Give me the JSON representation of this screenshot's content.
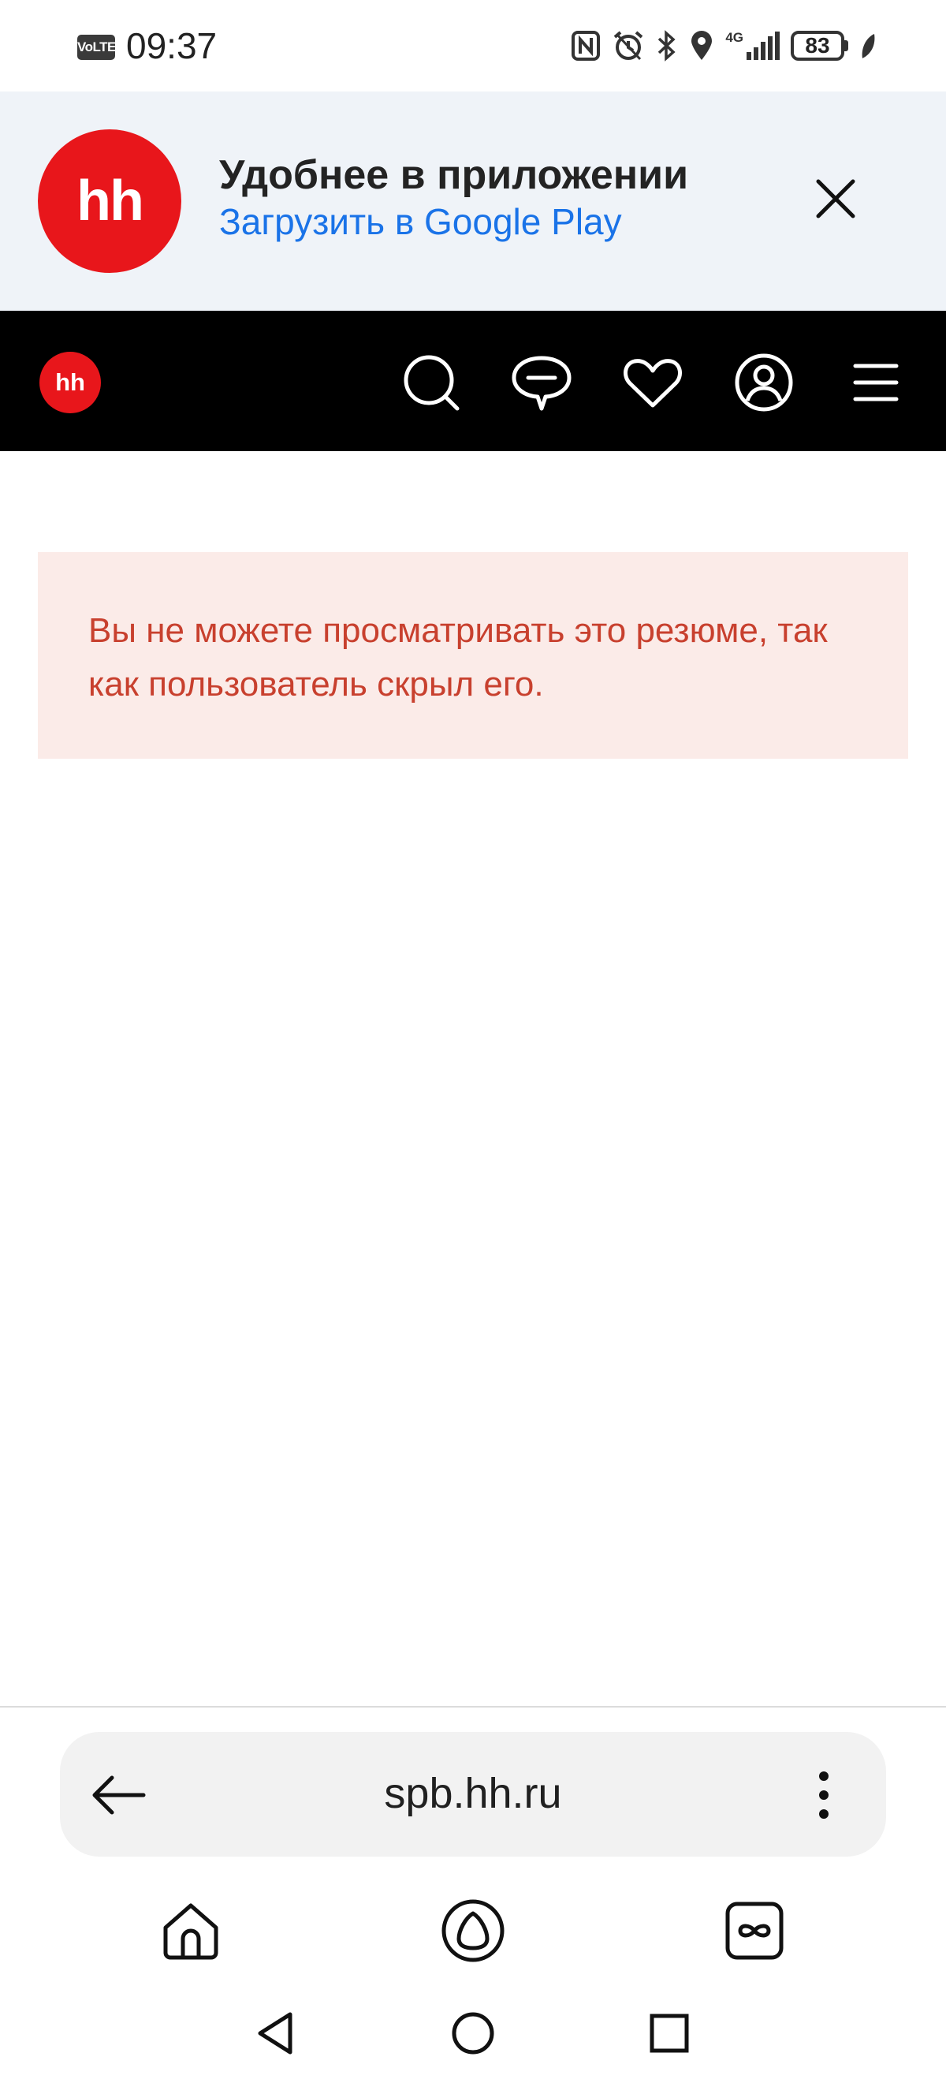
{
  "status_bar": {
    "volte": "VoLTE",
    "time": "09:37",
    "network": "4G",
    "battery": "83",
    "icons": [
      "nfc-icon",
      "alarm-icon",
      "bluetooth-icon",
      "location-icon",
      "signal-icon",
      "battery-icon",
      "leaf-icon"
    ]
  },
  "app_banner": {
    "logo_text": "hh",
    "title": "Удобнее в приложении",
    "link": "Загрузить в Google Play",
    "close_icon": "close-icon",
    "background": "#eff3f8",
    "link_color": "#1a73e8"
  },
  "header": {
    "logo_text": "hh",
    "icons": [
      "search-icon",
      "chat-icon",
      "heart-icon",
      "profile-icon",
      "menu-icon"
    ],
    "background": "#000000",
    "brand_color": "#e8161b"
  },
  "message": {
    "text": "Вы не можете просматривать это резюме, так как пользователь скрыл его.",
    "background": "#fbebe8",
    "text_color": "#c8402e"
  },
  "browser": {
    "url": "spb.hh.ru",
    "back_icon": "arrow-left-icon",
    "menu_icon": "more-vertical-icon",
    "toolbar": [
      "home-icon",
      "assistant-icon",
      "tabs-icon"
    ]
  },
  "system_nav": [
    "back-triangle-icon",
    "home-circle-icon",
    "recents-square-icon"
  ]
}
